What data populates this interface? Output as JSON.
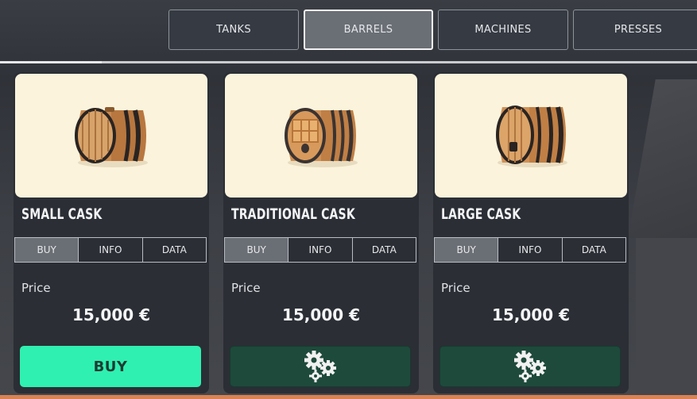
{
  "tabs": [
    {
      "label": "TANKS"
    },
    {
      "label": "BARRELS",
      "active": true
    },
    {
      "label": "MACHINES"
    },
    {
      "label": "PRESSES"
    }
  ],
  "cards": [
    {
      "title": "SMALL CASK",
      "image_icon": "small-cask-barrel",
      "subtabs": [
        "BUY",
        "INFO",
        "DATA"
      ],
      "active_subtab": "BUY",
      "price_label": "Price",
      "price": "15,000 €",
      "action": {
        "type": "buy",
        "label": "BUY"
      }
    },
    {
      "title": "TRADITIONAL CASK",
      "image_icon": "traditional-cask-barrel",
      "subtabs": [
        "BUY",
        "INFO",
        "DATA"
      ],
      "active_subtab": "BUY",
      "price_label": "Price",
      "price": "15,000 €",
      "action": {
        "type": "gears",
        "icon": "gears-icon"
      }
    },
    {
      "title": "LARGE CASK",
      "image_icon": "large-cask-barrel",
      "subtabs": [
        "BUY",
        "INFO",
        "DATA"
      ],
      "active_subtab": "BUY",
      "price_label": "Price",
      "price": "15,000 €",
      "action": {
        "type": "gears",
        "icon": "gears-icon"
      }
    }
  ],
  "colors": {
    "buy_button": "#2ff0b0",
    "gear_button": "#1e4a3c",
    "card_bg": "#2b2e35",
    "image_bg": "#fbf3dc",
    "accent_strip": "#d98253"
  }
}
